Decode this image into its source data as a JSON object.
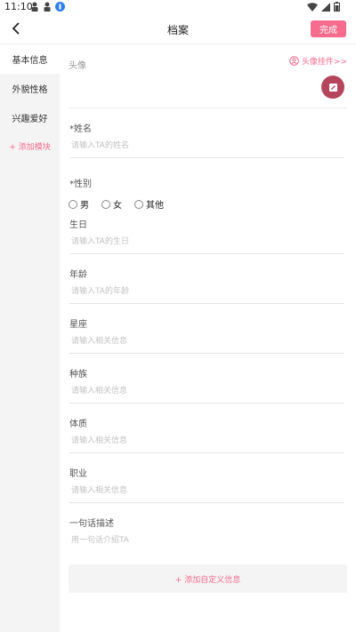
{
  "status_bar": {
    "time": "11:10"
  },
  "header": {
    "title": "档案",
    "done_label": "完成"
  },
  "sidebar": {
    "items": [
      {
        "label": "基本信息"
      },
      {
        "label": "外貌性格"
      },
      {
        "label": "兴趣爱好"
      }
    ],
    "add_module_label": "+ 添加模块"
  },
  "avatar": {
    "label": "头像",
    "widget_label": "头像挂件>>"
  },
  "fields": {
    "name": {
      "label": "*姓名",
      "placeholder": "请输入TA的姓名"
    },
    "gender": {
      "label": "*性别",
      "options": [
        "男",
        "女",
        "其他"
      ]
    },
    "birthday": {
      "label": "生日",
      "placeholder": "请输入TA的生日"
    },
    "age": {
      "label": "年龄",
      "placeholder": "请输入TA的年龄"
    },
    "zodiac": {
      "label": "星座",
      "placeholder": "请输入相关信息"
    },
    "race": {
      "label": "种族",
      "placeholder": "请输入相关信息"
    },
    "physique": {
      "label": "体质",
      "placeholder": "请输入相关信息"
    },
    "job": {
      "label": "职业",
      "placeholder": "请输入相关信息"
    },
    "oneliner": {
      "label": "一句话描述",
      "placeholder": "用一句话介绍TA"
    }
  },
  "add_custom_label": "+ 添加自定义信息",
  "colors": {
    "accent": "#f56c8e",
    "edit_button": "#b5455d",
    "sidebar_bg": "#f4f4f4"
  }
}
